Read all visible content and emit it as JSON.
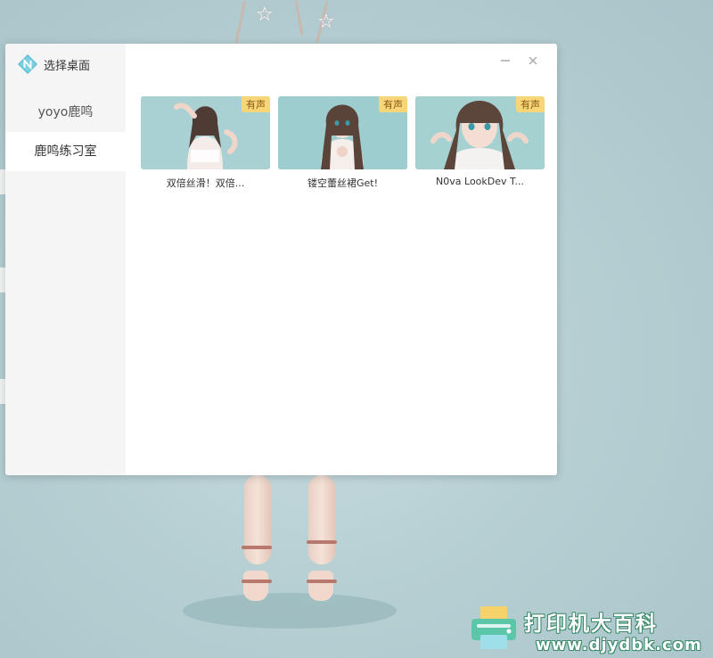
{
  "window": {
    "title": "选择桌面",
    "minimize_glyph": "—",
    "close_glyph": "✕"
  },
  "sidebar": {
    "items": [
      {
        "label": "yoyo鹿鸣",
        "active": false
      },
      {
        "label": "鹿鸣练习室",
        "active": true
      }
    ]
  },
  "cards": [
    {
      "title": "双倍丝滑！双倍...",
      "badge": "有声"
    },
    {
      "title": "镂空蕾丝裙Get!",
      "badge": "有声"
    },
    {
      "title": "N0va LookDev T...",
      "badge": "有声"
    }
  ],
  "watermark": {
    "title": "打印机大百科",
    "url": "www.djydbk.com"
  },
  "colors": {
    "accent_logo": "#5bc0d6",
    "badge_bg": "#f7d67a",
    "sidebar_bg": "#f5f5f5",
    "desktop_bg": "#b6cfd3"
  }
}
